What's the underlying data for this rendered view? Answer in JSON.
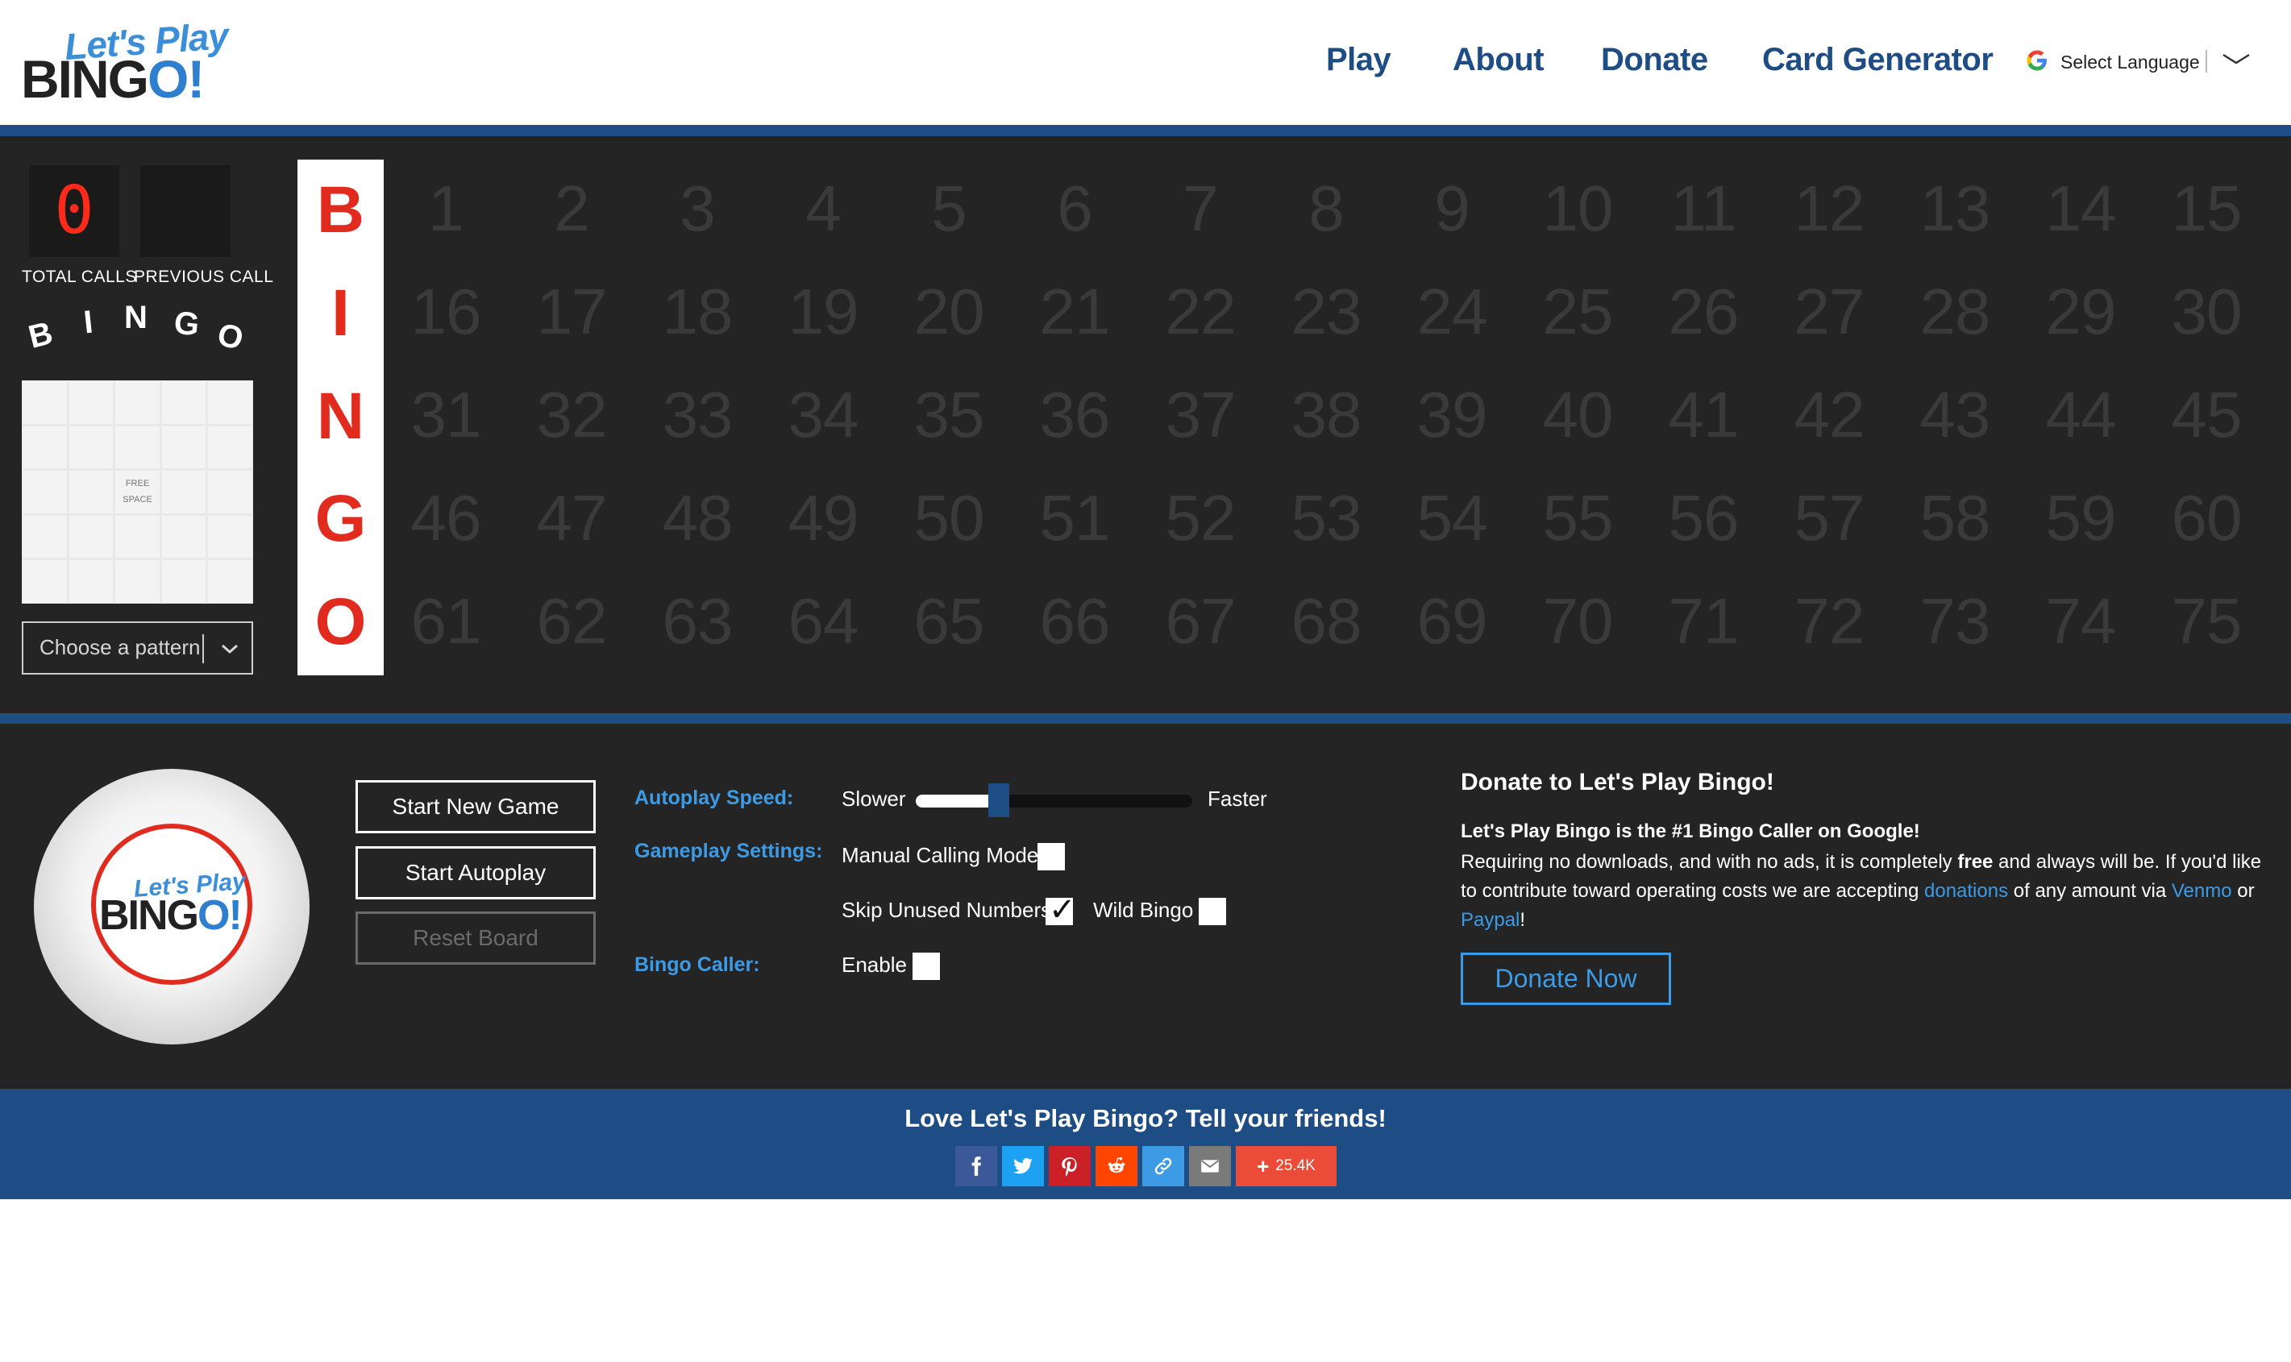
{
  "header": {
    "logo_top": "Let's Play",
    "logo_bottom_pre": "BING",
    "logo_bottom_o": "O!",
    "nav": [
      "Play",
      "About",
      "Donate",
      "Card Generator"
    ],
    "language_label": "Select Language"
  },
  "board": {
    "total_calls_value": "0",
    "previous_call_value": "",
    "total_calls_label": "TOTAL CALLS",
    "previous_call_label": "PREVIOUS CALL",
    "mini_letters": [
      "B",
      "I",
      "N",
      "G",
      "O"
    ],
    "free_space_line1": "FREE",
    "free_space_line2": "SPACE",
    "pattern_placeholder": "Choose a pattern",
    "column_letters": [
      "B",
      "I",
      "N",
      "G",
      "O"
    ],
    "numbers": [
      [
        "1",
        "2",
        "3",
        "4",
        "5",
        "6",
        "7",
        "8",
        "9",
        "10",
        "11",
        "12",
        "13",
        "14",
        "15"
      ],
      [
        "16",
        "17",
        "18",
        "19",
        "20",
        "21",
        "22",
        "23",
        "24",
        "25",
        "26",
        "27",
        "28",
        "29",
        "30"
      ],
      [
        "31",
        "32",
        "33",
        "34",
        "35",
        "36",
        "37",
        "38",
        "39",
        "40",
        "41",
        "42",
        "43",
        "44",
        "45"
      ],
      [
        "46",
        "47",
        "48",
        "49",
        "50",
        "51",
        "52",
        "53",
        "54",
        "55",
        "56",
        "57",
        "58",
        "59",
        "60"
      ],
      [
        "61",
        "62",
        "63",
        "64",
        "65",
        "66",
        "67",
        "68",
        "69",
        "70",
        "71",
        "72",
        "73",
        "74",
        "75"
      ]
    ]
  },
  "controls": {
    "ball_top": "Let's Play",
    "ball_bottom_pre": "BING",
    "ball_bottom_o": "O!",
    "buttons": {
      "start_new_game": "Start New Game",
      "start_autoplay": "Start Autoplay",
      "reset_board": "Reset Board"
    },
    "autoplay_speed_label": "Autoplay Speed:",
    "slower": "Slower",
    "faster": "Faster",
    "autoplay_speed_fraction": 0.3,
    "gameplay_settings_label": "Gameplay Settings:",
    "manual_calling_mode": "Manual Calling Mode",
    "manual_calling_checked": false,
    "skip_unused_numbers": "Skip Unused Numbers",
    "skip_unused_checked": true,
    "wild_bingo": "Wild Bingo",
    "wild_bingo_checked": false,
    "bingo_caller_label": "Bingo Caller:",
    "enable": "Enable",
    "enable_checked": false
  },
  "donate": {
    "title": "Donate to Let's Play Bingo!",
    "subtitle": "Let's Play Bingo is the #1 Bingo Caller on Google!",
    "body_1": "Requiring no downloads, and with no ads, it is completely ",
    "body_free": "free",
    "body_2": " and always will be. If you'd like to contribute toward operating costs we are accepting ",
    "link_donations": "donations",
    "body_3": " of any amount via ",
    "link_venmo": "Venmo",
    "body_4": " or ",
    "link_paypal": "Paypal",
    "body_5": "!",
    "button": "Donate Now"
  },
  "share": {
    "title": "Love Let's Play Bingo? Tell your friends!",
    "count": "25.4K",
    "buttons": [
      {
        "icon": "facebook-icon",
        "color": "#3b5998"
      },
      {
        "icon": "twitter-icon",
        "color": "#1da1f2"
      },
      {
        "icon": "pinterest-icon",
        "color": "#cb2027"
      },
      {
        "icon": "reddit-icon",
        "color": "#ff4500"
      },
      {
        "icon": "link-icon",
        "color": "#3d9be6"
      },
      {
        "icon": "email-icon",
        "color": "#7a7a7a"
      }
    ]
  },
  "colors": {
    "brand_blue": "#1d4d84",
    "accent_blue": "#3d9be6",
    "bingo_red": "#e12b1f",
    "panel_dark": "#242424"
  }
}
